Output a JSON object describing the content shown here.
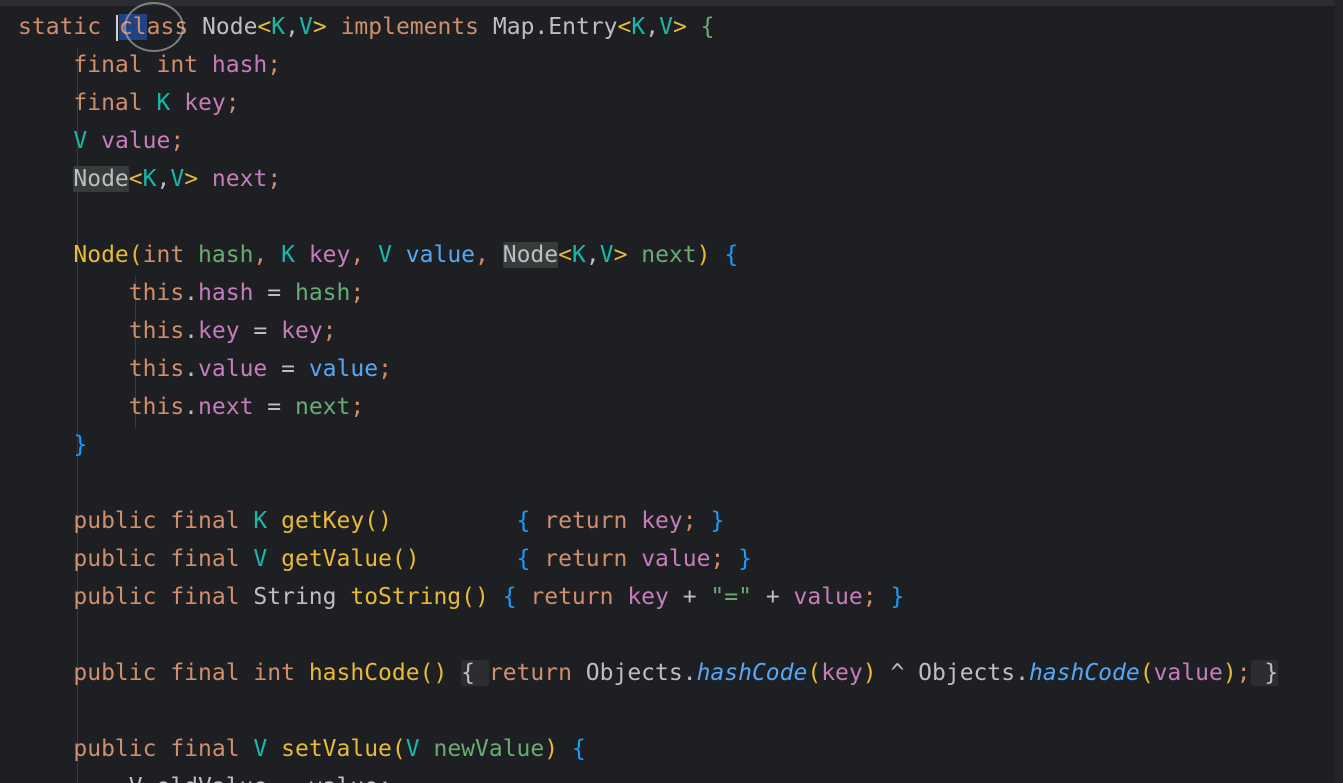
{
  "code": {
    "lines": [
      [
        {
          "t": "static ",
          "c": "kw"
        },
        {
          "t": "",
          "c": "caret"
        },
        {
          "t": "cl",
          "c": "kw hl-sel"
        },
        {
          "t": "ass ",
          "c": "kw"
        },
        {
          "t": "Node",
          "c": "cls"
        },
        {
          "t": "<",
          "c": "brY"
        },
        {
          "t": "K",
          "c": "tp"
        },
        {
          "t": ",",
          "c": "plain"
        },
        {
          "t": "V",
          "c": "tp"
        },
        {
          "t": "> ",
          "c": "brY"
        },
        {
          "t": "implements ",
          "c": "kw"
        },
        {
          "t": "Map.Entry",
          "c": "cls"
        },
        {
          "t": "<",
          "c": "brY"
        },
        {
          "t": "K",
          "c": "tp"
        },
        {
          "t": ",",
          "c": "plain"
        },
        {
          "t": "V",
          "c": "tp"
        },
        {
          "t": "> ",
          "c": "brY"
        },
        {
          "t": "{",
          "c": "grn"
        }
      ],
      [
        {
          "t": "    final ",
          "c": "kw"
        },
        {
          "t": "int ",
          "c": "kw"
        },
        {
          "t": "hash",
          "c": "fld"
        },
        {
          "t": ";",
          "c": "kw"
        }
      ],
      [
        {
          "t": "    final ",
          "c": "kw"
        },
        {
          "t": "K ",
          "c": "tp"
        },
        {
          "t": "key",
          "c": "fld"
        },
        {
          "t": ";",
          "c": "kw"
        }
      ],
      [
        {
          "t": "    ",
          "c": "plain"
        },
        {
          "t": "V ",
          "c": "tp"
        },
        {
          "t": "value",
          "c": "fld"
        },
        {
          "t": ";",
          "c": "kw"
        }
      ],
      [
        {
          "t": "    ",
          "c": "plain"
        },
        {
          "t": "Node",
          "c": "cls hl-usage"
        },
        {
          "t": "<",
          "c": "brY"
        },
        {
          "t": "K",
          "c": "tp"
        },
        {
          "t": ",",
          "c": "plain"
        },
        {
          "t": "V",
          "c": "tp"
        },
        {
          "t": "> ",
          "c": "brY"
        },
        {
          "t": "next",
          "c": "fld"
        },
        {
          "t": ";",
          "c": "kw"
        }
      ],
      [],
      [
        {
          "t": "    ",
          "c": "plain"
        },
        {
          "t": "Node",
          "c": "ctor"
        },
        {
          "t": "(",
          "c": "brY"
        },
        {
          "t": "int ",
          "c": "kw"
        },
        {
          "t": "hash",
          "c": "grn"
        },
        {
          "t": ", ",
          "c": "kw"
        },
        {
          "t": "K ",
          "c": "tp"
        },
        {
          "t": "key",
          "c": "fld"
        },
        {
          "t": ", ",
          "c": "kw"
        },
        {
          "t": "V ",
          "c": "tp"
        },
        {
          "t": "value",
          "c": "par"
        },
        {
          "t": ", ",
          "c": "kw"
        },
        {
          "t": "Node",
          "c": "cls hl-usage"
        },
        {
          "t": "<",
          "c": "brY"
        },
        {
          "t": "K",
          "c": "tp"
        },
        {
          "t": ",",
          "c": "plain"
        },
        {
          "t": "V",
          "c": "tp"
        },
        {
          "t": "> ",
          "c": "brY"
        },
        {
          "t": "next",
          "c": "grn"
        },
        {
          "t": ") ",
          "c": "brY"
        },
        {
          "t": "{",
          "c": "brB"
        }
      ],
      [
        {
          "t": "        this",
          "c": "kw"
        },
        {
          "t": ".",
          "c": "plain"
        },
        {
          "t": "hash",
          "c": "fld"
        },
        {
          "t": " = ",
          "c": "plain"
        },
        {
          "t": "hash",
          "c": "grn"
        },
        {
          "t": ";",
          "c": "kw"
        }
      ],
      [
        {
          "t": "        this",
          "c": "kw"
        },
        {
          "t": ".",
          "c": "plain"
        },
        {
          "t": "key",
          "c": "fld"
        },
        {
          "t": " = ",
          "c": "plain"
        },
        {
          "t": "key",
          "c": "fld"
        },
        {
          "t": ";",
          "c": "kw"
        }
      ],
      [
        {
          "t": "        this",
          "c": "kw"
        },
        {
          "t": ".",
          "c": "plain"
        },
        {
          "t": "value",
          "c": "fld"
        },
        {
          "t": " = ",
          "c": "plain"
        },
        {
          "t": "value",
          "c": "par"
        },
        {
          "t": ";",
          "c": "kw"
        }
      ],
      [
        {
          "t": "        this",
          "c": "kw"
        },
        {
          "t": ".",
          "c": "plain"
        },
        {
          "t": "next",
          "c": "fld"
        },
        {
          "t": " = ",
          "c": "plain"
        },
        {
          "t": "next",
          "c": "grn"
        },
        {
          "t": ";",
          "c": "kw"
        }
      ],
      [
        {
          "t": "    ",
          "c": "plain"
        },
        {
          "t": "}",
          "c": "brB"
        }
      ],
      [],
      [
        {
          "t": "    public ",
          "c": "kw"
        },
        {
          "t": "final ",
          "c": "kw"
        },
        {
          "t": "K ",
          "c": "tp"
        },
        {
          "t": "getKey",
          "c": "fn"
        },
        {
          "t": "()",
          "c": "brY"
        },
        {
          "t": "         ",
          "c": "plain"
        },
        {
          "t": "{ ",
          "c": "brB"
        },
        {
          "t": "return ",
          "c": "kw"
        },
        {
          "t": "key",
          "c": "fld"
        },
        {
          "t": "; ",
          "c": "kw"
        },
        {
          "t": "}",
          "c": "brB"
        }
      ],
      [
        {
          "t": "    public ",
          "c": "kw"
        },
        {
          "t": "final ",
          "c": "kw"
        },
        {
          "t": "V ",
          "c": "tp"
        },
        {
          "t": "getValue",
          "c": "fn"
        },
        {
          "t": "()",
          "c": "brY"
        },
        {
          "t": "       ",
          "c": "plain"
        },
        {
          "t": "{ ",
          "c": "brB"
        },
        {
          "t": "return ",
          "c": "kw"
        },
        {
          "t": "value",
          "c": "fld"
        },
        {
          "t": "; ",
          "c": "kw"
        },
        {
          "t": "}",
          "c": "brB"
        }
      ],
      [
        {
          "t": "    public ",
          "c": "kw"
        },
        {
          "t": "final ",
          "c": "kw"
        },
        {
          "t": "String ",
          "c": "cls"
        },
        {
          "t": "toString",
          "c": "fn"
        },
        {
          "t": "() ",
          "c": "brY"
        },
        {
          "t": "{ ",
          "c": "brB"
        },
        {
          "t": "return ",
          "c": "kw"
        },
        {
          "t": "key",
          "c": "fld"
        },
        {
          "t": " + ",
          "c": "plain"
        },
        {
          "t": "\"=\"",
          "c": "strC"
        },
        {
          "t": " + ",
          "c": "plain"
        },
        {
          "t": "value",
          "c": "fld"
        },
        {
          "t": "; ",
          "c": "kw"
        },
        {
          "t": "}",
          "c": "brB"
        }
      ],
      [],
      [
        {
          "t": "    public ",
          "c": "kw"
        },
        {
          "t": "final ",
          "c": "kw"
        },
        {
          "t": "int ",
          "c": "kw"
        },
        {
          "t": "hashCode",
          "c": "fn"
        },
        {
          "t": "() ",
          "c": "brY"
        },
        {
          "t": "{ ",
          "c": "plain hl-fold"
        },
        {
          "t": "return ",
          "c": "kw"
        },
        {
          "t": "Objects.",
          "c": "cls"
        },
        {
          "t": "hashCode",
          "c": "itl"
        },
        {
          "t": "(",
          "c": "brY"
        },
        {
          "t": "key",
          "c": "fld"
        },
        {
          "t": ")",
          "c": "brY"
        },
        {
          "t": " ^ ",
          "c": "plain"
        },
        {
          "t": "Objects.",
          "c": "cls"
        },
        {
          "t": "hashCode",
          "c": "itl"
        },
        {
          "t": "(",
          "c": "brY"
        },
        {
          "t": "value",
          "c": "fld"
        },
        {
          "t": ")",
          "c": "brY"
        },
        {
          "t": ";",
          "c": "kw"
        },
        {
          "t": " }",
          "c": "plain hl-fold"
        }
      ],
      [],
      [
        {
          "t": "    public ",
          "c": "kw"
        },
        {
          "t": "final ",
          "c": "kw"
        },
        {
          "t": "V ",
          "c": "tp"
        },
        {
          "t": "setValue",
          "c": "fn"
        },
        {
          "t": "(",
          "c": "brY"
        },
        {
          "t": "V ",
          "c": "tp"
        },
        {
          "t": "newValue",
          "c": "grn"
        },
        {
          "t": ") ",
          "c": "brY"
        },
        {
          "t": "{",
          "c": "brB"
        }
      ],
      [
        {
          "t": "        V oldValue = value;",
          "c": "plain"
        }
      ]
    ]
  },
  "theme": {
    "background": "#1e1f22",
    "keyword": "#cf8e6d",
    "field": "#c77dbb",
    "function": "#e8ba36",
    "type_param": "#16baac",
    "parameter": "#56a8f5",
    "string": "#6aab73",
    "selection": "#214283"
  }
}
